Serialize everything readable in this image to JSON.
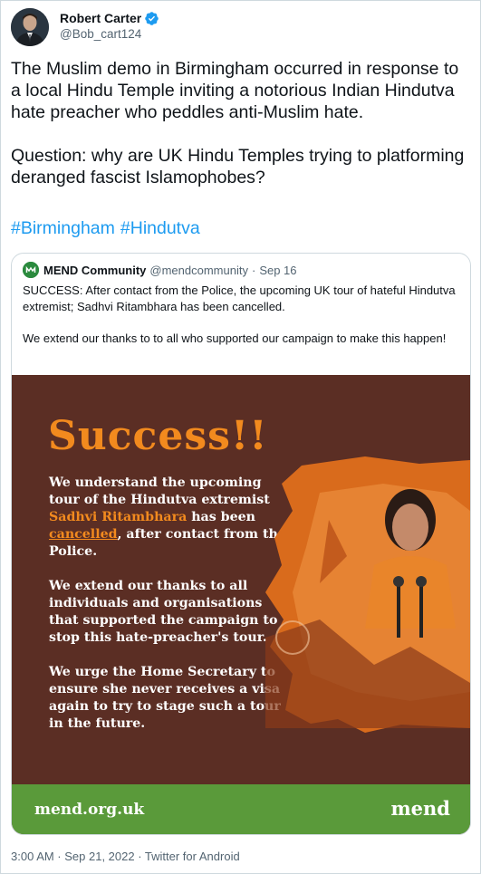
{
  "author": {
    "name": "Robert Carter",
    "handle": "@Bob_cart124",
    "verified_icon": "verified-badge-icon"
  },
  "tweet": {
    "paragraph1": "The Muslim demo in Birmingham occurred in response to a local Hindu Temple inviting a notorious Indian Hindutva hate preacher who peddles anti-Muslim hate.",
    "paragraph2": "Question: why are UK Hindu Temples trying to platforming deranged fascist Islamophobes?",
    "hashtags": [
      "#Birmingham",
      "#Hindutva"
    ],
    "link_color": "#1d9bf0"
  },
  "quoted": {
    "name": "MEND Community",
    "handle": "@mendcommunity",
    "separator": "·",
    "date": "Sep 16",
    "text1": "SUCCESS: After contact from the Police, the upcoming UK tour of hateful Hindutva extremist; Sadhvi Ritambhara has been cancelled.",
    "text2": "We extend our thanks to to all who supported our campaign to make this happen!"
  },
  "poster": {
    "headline": "Success!!",
    "p1_a": "We understand the upcoming tour of the Hindutva extremist ",
    "p1_name": "Sadhvi Ritambhara",
    "p1_b": " has been ",
    "p1_cancelled": "cancelled",
    "p1_c": ", after contact from the Police.",
    "p2": "We extend our thanks to all individuals and organisations that supported the campaign to stop this hate-preacher's tour.",
    "p3": "We urge the Home Secretary to ensure she never receives a visa again to try to stage such a tour in the future.",
    "footer_url": "mend.org.uk",
    "footer_logo": "mend",
    "colors": {
      "background": "#5b2e24",
      "accent": "#f28a1e",
      "footer": "#5a9a3a"
    }
  },
  "meta": {
    "timestamp": "3:00 AM · Sep 21, 2022 · Twitter for Android"
  }
}
